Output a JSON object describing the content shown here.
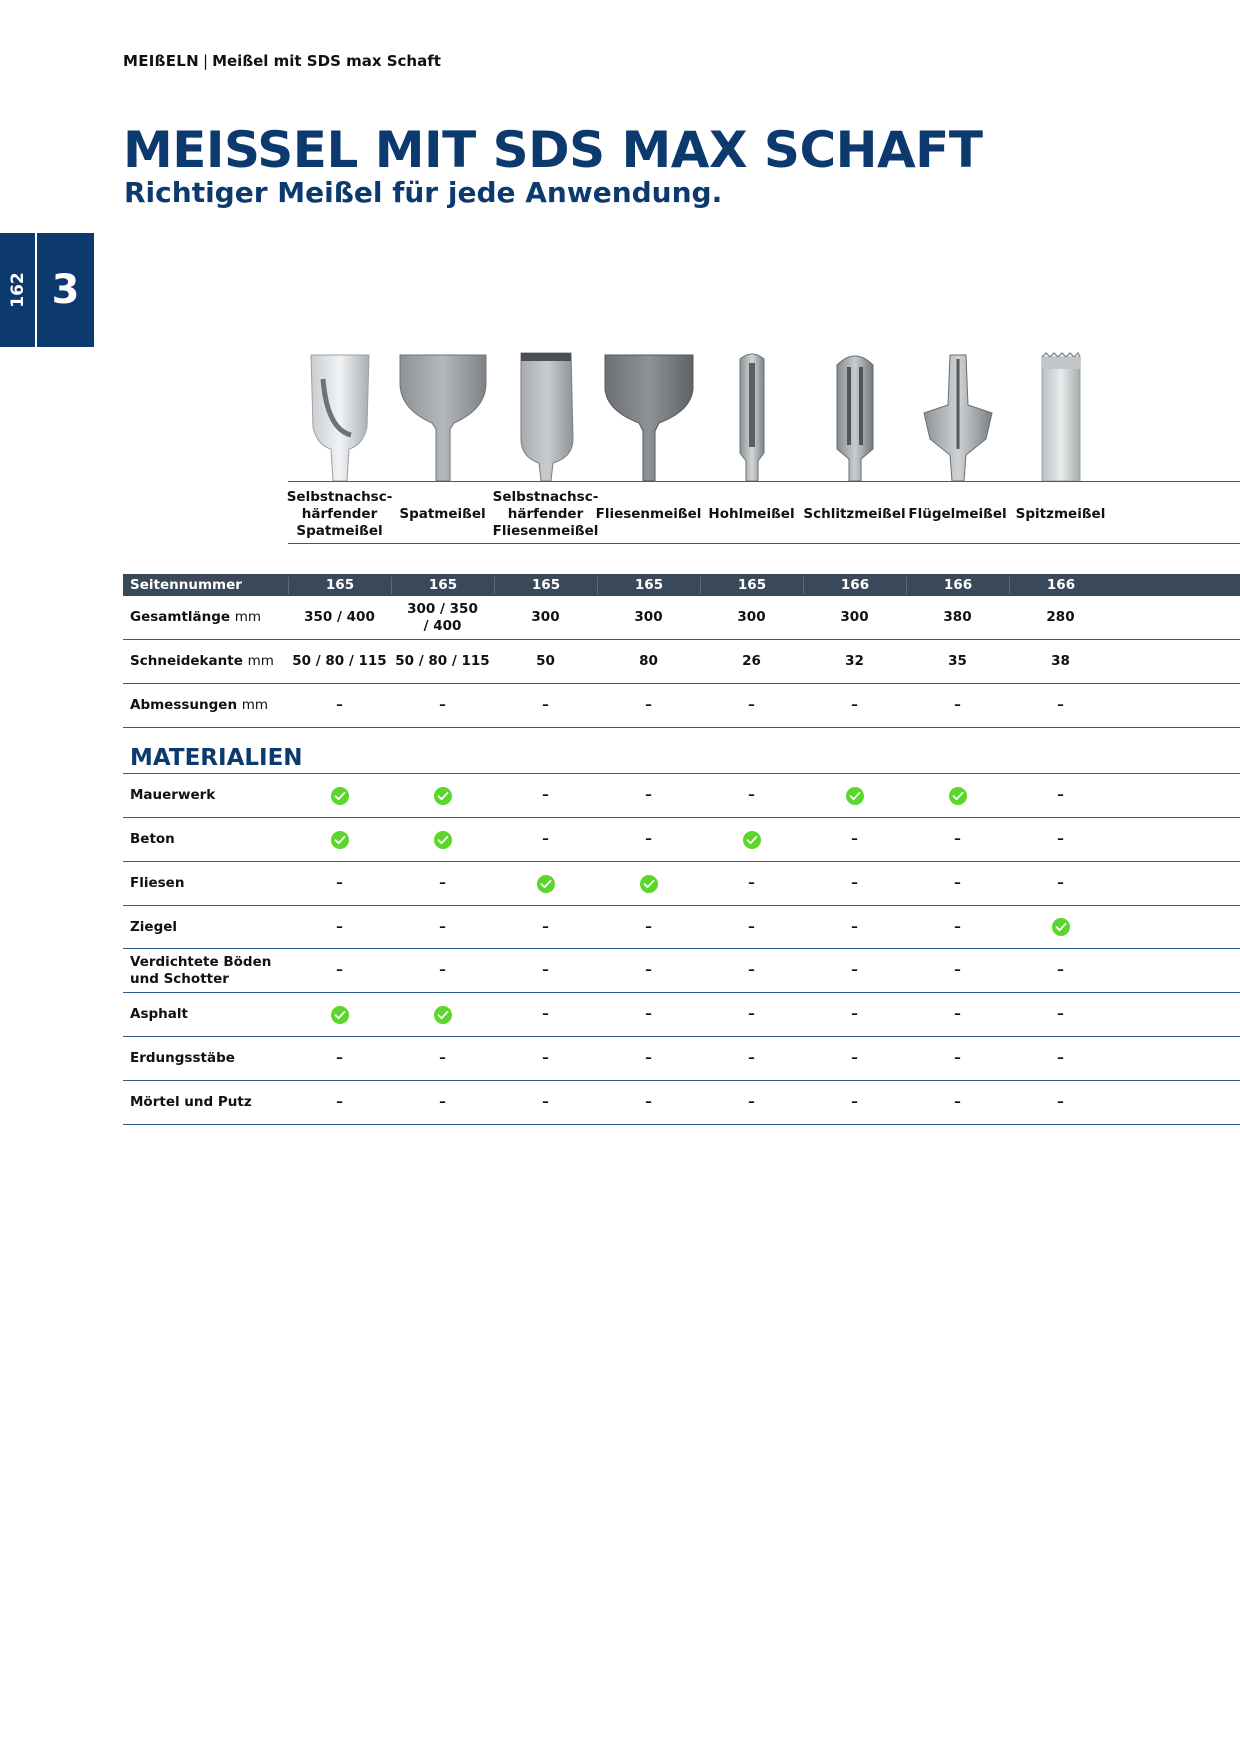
{
  "breadcrumb": {
    "main": "MEIßELN",
    "separator": "|",
    "sub": "Meißel mit SDS max Schaft"
  },
  "title": "MEISSEL MIT SDS MAX SCHAFT",
  "subtitle": "Richtiger Meißel für jede Anwendung.",
  "side_tab": {
    "page_number": "162",
    "chapter": "3"
  },
  "tools": [
    {
      "name": "Selbstnachsc-härfender Spatmeißel",
      "lines": [
        "Selbstnachsc-",
        "härfender",
        "Spatmeißel"
      ],
      "icon": "spade-chisel-self-sharpening-icon"
    },
    {
      "name": "Spatmeißel",
      "lines": [
        "Spatmeißel"
      ],
      "icon": "spade-chisel-icon"
    },
    {
      "name": "Selbstnachsc-härfender Fliesenmeißel",
      "lines": [
        "Selbstnachsc-",
        "härfender",
        "Fliesenmeißel"
      ],
      "icon": "tile-chisel-self-sharpening-icon"
    },
    {
      "name": "Fliesenmeißel",
      "lines": [
        "Fliesenmeißel"
      ],
      "icon": "tile-chisel-icon"
    },
    {
      "name": "Hohlmeißel",
      "lines": [
        "Hohlmeißel"
      ],
      "icon": "gouge-chisel-icon"
    },
    {
      "name": "Schlitzmeißel",
      "lines": [
        "Schlitzmeißel"
      ],
      "icon": "channel-chisel-icon"
    },
    {
      "name": "Flügelmeißel",
      "lines": [
        "Flügelmeißel"
      ],
      "icon": "wing-chisel-icon"
    },
    {
      "name": "Spitzmeißel",
      "lines": [
        "Spitzmeißel"
      ],
      "icon": "point-chisel-icon"
    }
  ],
  "specs": {
    "header": {
      "label": "Seitennummer",
      "values": [
        "165",
        "165",
        "165",
        "165",
        "165",
        "166",
        "166",
        "166"
      ]
    },
    "rows": [
      {
        "label": "Gesamtlänge",
        "unit": "mm",
        "values": [
          "350 / 400",
          "300 / 350 / 400",
          "300",
          "300",
          "300",
          "300",
          "380",
          "280"
        ]
      },
      {
        "label": "Schneidekante",
        "unit": "mm",
        "values": [
          "50 / 80 / 115",
          "50 / 80 / 115",
          "50",
          "80",
          "26",
          "32",
          "35",
          "38"
        ]
      },
      {
        "label": "Abmessungen",
        "unit": "mm",
        "values": [
          "–",
          "–",
          "–",
          "–",
          "–",
          "–",
          "–",
          "–"
        ]
      }
    ]
  },
  "materials": {
    "title": "MATERIALIEN",
    "dash": "–",
    "check_color": "#5bd62b",
    "rows": [
      {
        "label": "Mauerwerk",
        "values": [
          true,
          true,
          false,
          false,
          false,
          true,
          true,
          false
        ]
      },
      {
        "label": "Beton",
        "values": [
          true,
          true,
          false,
          false,
          true,
          false,
          false,
          false
        ]
      },
      {
        "label": "Fliesen",
        "values": [
          false,
          false,
          true,
          true,
          false,
          false,
          false,
          false
        ]
      },
      {
        "label": "Ziegel",
        "values": [
          false,
          false,
          false,
          false,
          false,
          false,
          false,
          true
        ]
      },
      {
        "label": "Verdichtete Böden und Schotter",
        "values": [
          false,
          false,
          false,
          false,
          false,
          false,
          false,
          false
        ]
      },
      {
        "label": "Asphalt",
        "values": [
          true,
          true,
          false,
          false,
          false,
          false,
          false,
          false
        ]
      },
      {
        "label": "Erdungsstäbe",
        "values": [
          false,
          false,
          false,
          false,
          false,
          false,
          false,
          false
        ]
      },
      {
        "label": "Mörtel und Putz",
        "values": [
          false,
          false,
          false,
          false,
          false,
          false,
          false,
          false
        ]
      }
    ]
  },
  "colors": {
    "brand_blue": "#0d3a6e",
    "header_bg": "#39495a",
    "rule": "#2f5f91"
  }
}
